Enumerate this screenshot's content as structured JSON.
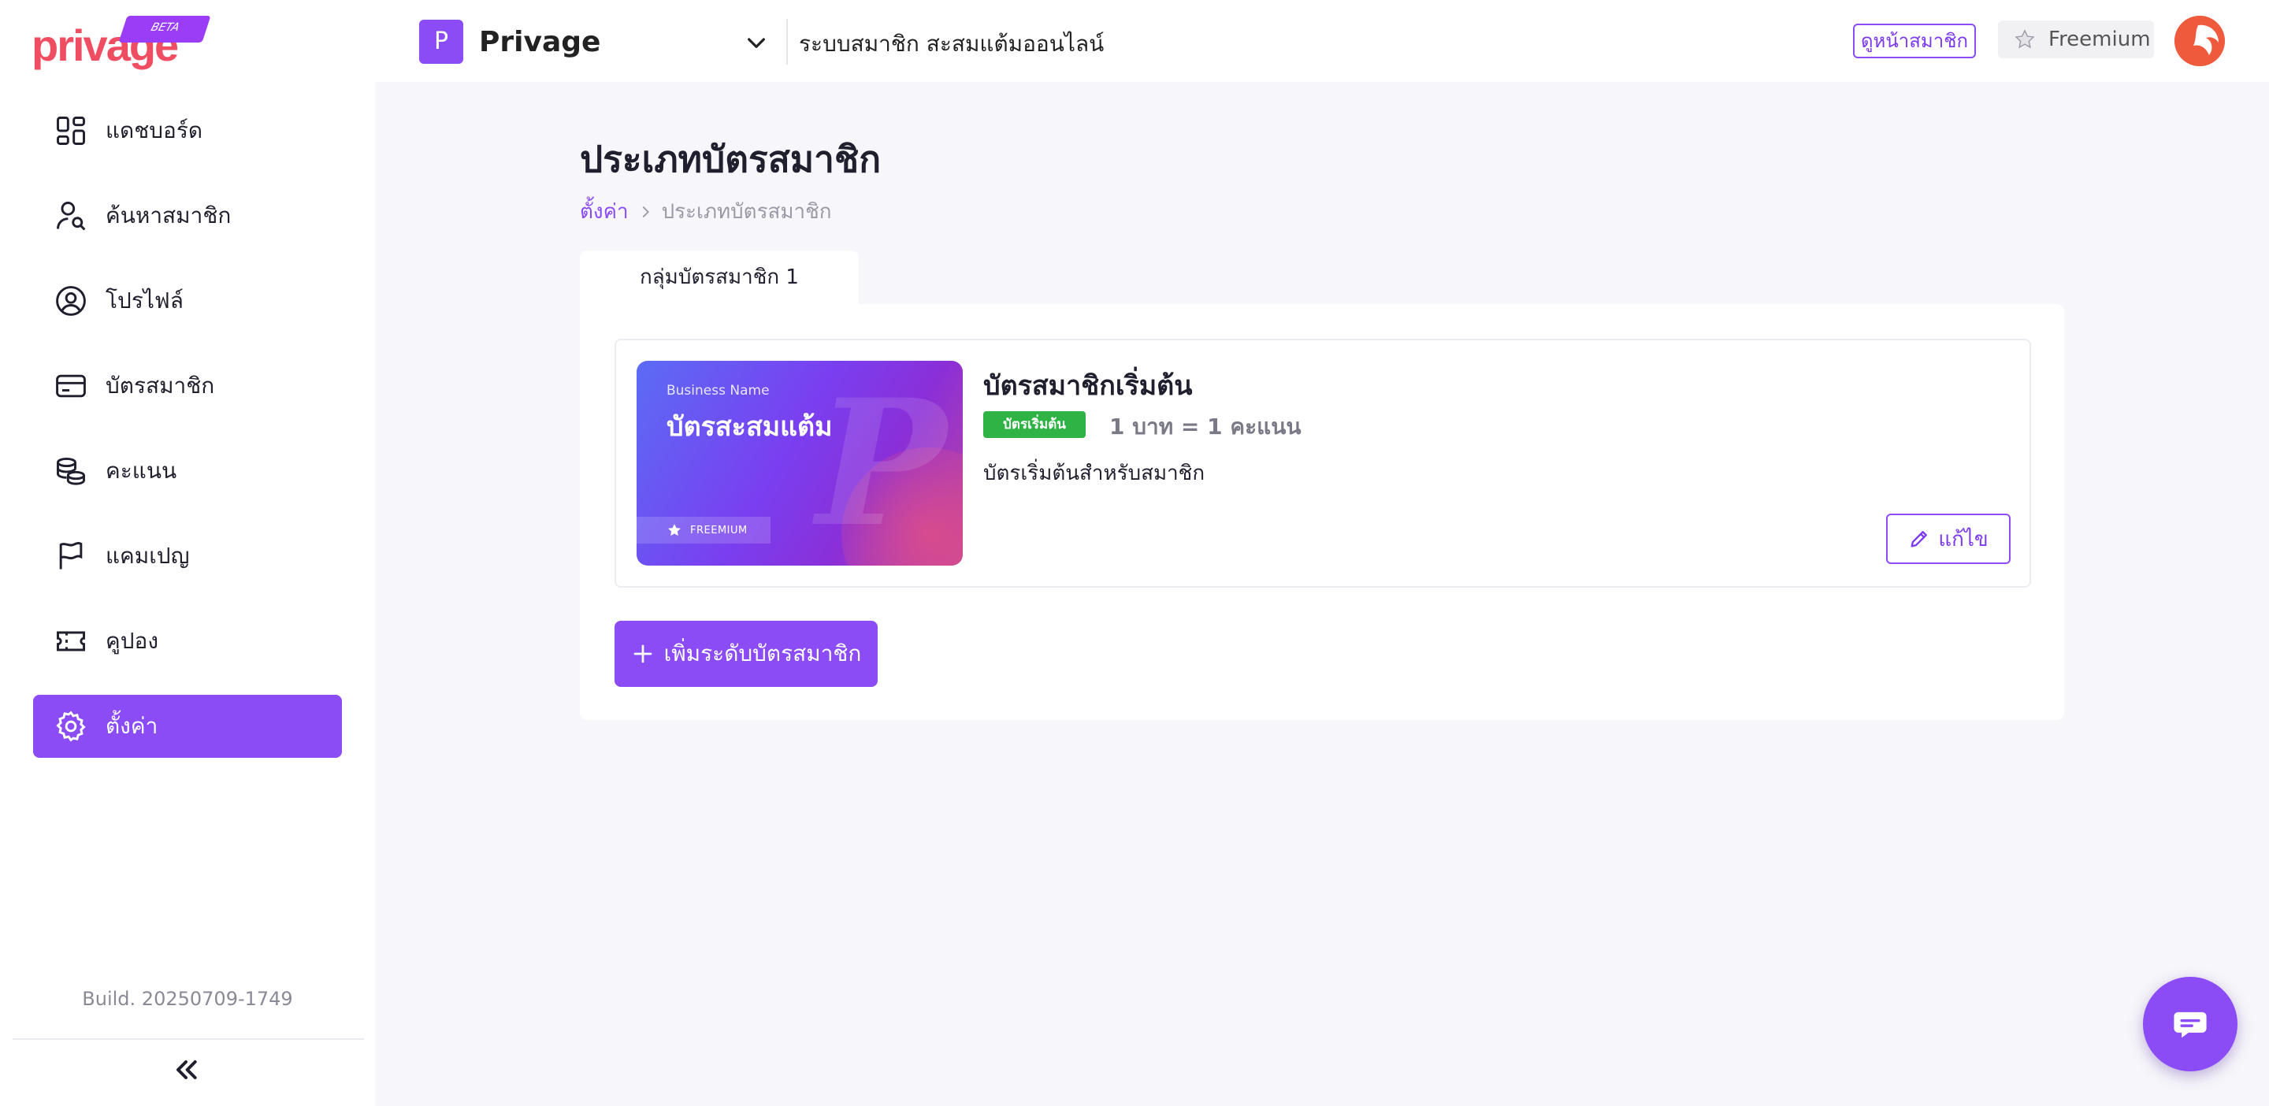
{
  "header": {
    "logo_text": "privage",
    "logo_badge": "BETA",
    "workspace_initial": "P",
    "workspace_name": "Privage",
    "app_description": "ระบบสมาชิก สะสมแต้มออนไลน์",
    "view_members_label": "ดูหน้าสมาชิก",
    "plan_label": "Freemium",
    "plan_icon": "star-icon"
  },
  "sidebar": {
    "items": [
      {
        "label": "แดชบอร์ด",
        "icon": "dashboard-icon",
        "active": false
      },
      {
        "label": "ค้นหาสมาชิก",
        "icon": "member-search-icon",
        "active": false
      },
      {
        "label": "โปรไฟล์",
        "icon": "profile-icon",
        "active": false
      },
      {
        "label": "บัตรสมาชิก",
        "icon": "card-icon",
        "active": false
      },
      {
        "label": "คะแนน",
        "icon": "coins-icon",
        "active": false
      },
      {
        "label": "แคมเปญ",
        "icon": "flag-icon",
        "active": false
      },
      {
        "label": "คูปอง",
        "icon": "ticket-icon",
        "active": false
      },
      {
        "label": "ตั้งค่า",
        "icon": "gear-icon",
        "active": true
      }
    ],
    "build": "Build. 20250709-1749",
    "collapse_icon": "double-chevron-left-icon"
  },
  "main": {
    "title": "ประเภทบัตรสมาชิก",
    "breadcrumb": {
      "parent": "ตั้งค่า",
      "current": "ประเภทบัตรสมาชิก"
    },
    "tabs": [
      {
        "label": "กลุ่มบัตรสมาชิก 1",
        "active": true
      }
    ],
    "tiers": [
      {
        "card_business_name": "Business Name",
        "card_title": "บัตรสะสมแต้ม",
        "card_footer": "FREEMIUM",
        "name": "บัตรสมาชิกเริ่มต้น",
        "badge": "บัตรเริ่มต้น",
        "rate": "1 บาท = 1 คะแนน",
        "description": "บัตรเริ่มต้นสำหรับสมาชิก",
        "edit_label": "แก้ไข"
      }
    ],
    "add_tier_label": "เพิ่มระดับบัตรสมาชิก"
  },
  "colors": {
    "accent": "#8b4cf6",
    "logo": "#ef4e62",
    "badge_green": "#2fb344",
    "avatar": "#ef5a3c"
  }
}
